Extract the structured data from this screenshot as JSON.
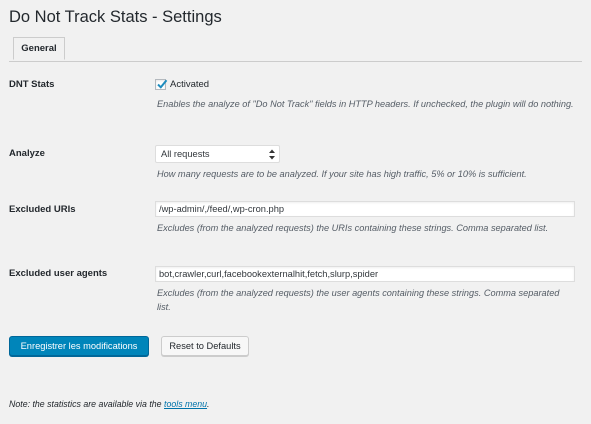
{
  "page": {
    "title": "Do Not Track Stats - Settings"
  },
  "tabs": [
    {
      "label": "General",
      "active": true
    }
  ],
  "fields": {
    "dnt_stats": {
      "label": "DNT Stats",
      "checkbox_label": "Activated",
      "checked": true,
      "description": "Enables the analyze of \"Do Not Track\" fields in HTTP headers. If unchecked, the plugin will do nothing."
    },
    "analyze": {
      "label": "Analyze",
      "selected": "All requests",
      "description": "How many requests are to be analyzed. If your site has high traffic, 5% or 10% is sufficient."
    },
    "excluded_uris": {
      "label": "Excluded URIs",
      "value": "/wp-admin/,/feed/,wp-cron.php",
      "description": "Excludes (from the analyzed requests) the URIs containing these strings. Comma separated list."
    },
    "excluded_user_agents": {
      "label": "Excluded user agents",
      "value": "bot,crawler,curl,facebookexternalhit,fetch,slurp,spider",
      "description": "Excludes (from the analyzed requests) the user agents containing these strings. Comma separated list."
    }
  },
  "buttons": {
    "save_label": "Enregistrer les modifications",
    "reset_label": "Reset to Defaults"
  },
  "footnote": {
    "prefix": "Note: the statistics are available via the ",
    "link_text": "tools menu",
    "suffix": "."
  },
  "colors": {
    "primary": "#0085ba",
    "link": "#0073aa",
    "background": "#f1f1f1"
  }
}
